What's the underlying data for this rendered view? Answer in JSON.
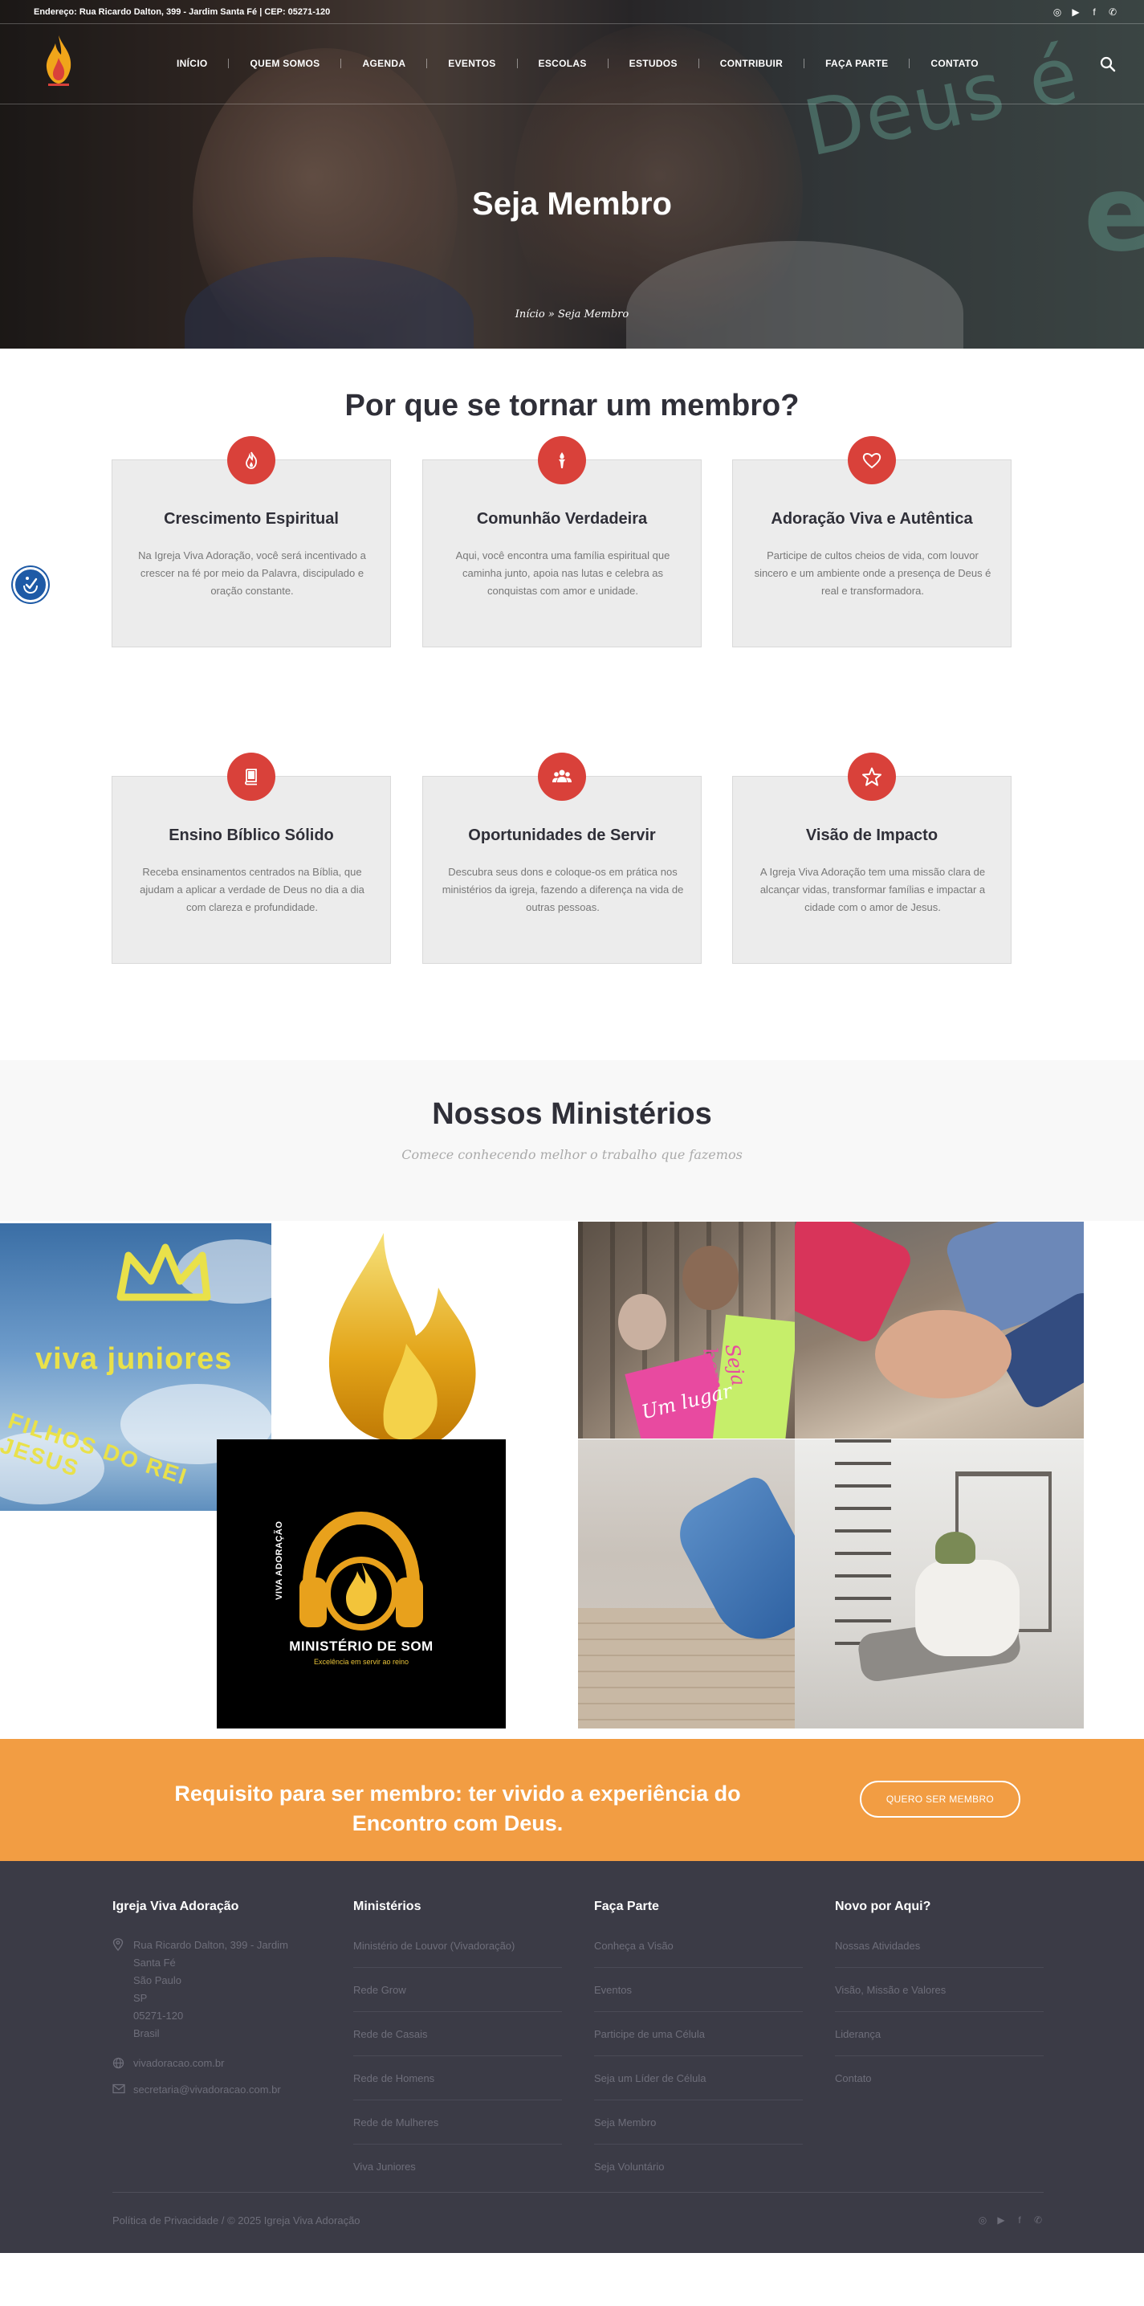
{
  "topbar": {
    "address": "Endereço: Rua Ricardo Dalton, 399 - Jardim Santa Fé | CEP: 05271-120",
    "social": [
      "instagram-icon",
      "youtube-icon",
      "facebook-icon",
      "whatsapp-icon"
    ]
  },
  "nav": {
    "items": [
      "INÍCIO",
      "QUEM SOMOS",
      "AGENDA",
      "EVENTOS",
      "ESCOLAS",
      "ESTUDOS",
      "CONTRIBUIR",
      "FAÇA PARTE",
      "CONTATO"
    ]
  },
  "hero": {
    "title": "Seja Membro",
    "breadcrumb": {
      "home": "Início",
      "separator": "»",
      "current": "Seja Membro"
    },
    "background_text": "Deus é"
  },
  "why": {
    "title": "Por que se tornar um membro?",
    "cards": [
      {
        "icon": "fire-icon",
        "title": "Crescimento Espiritual",
        "text": "Na Igreja Viva Adoração, você será incentivado a crescer na fé por meio da Palavra, discipulado e oração constante."
      },
      {
        "icon": "torch-icon",
        "title": "Comunhão Verdadeira",
        "text": "Aqui, você encontra uma família espiritual que caminha junto, apoia nas lutas e celebra as conquistas com amor e unidade."
      },
      {
        "icon": "heart-icon",
        "title": "Adoração Viva e Autêntica",
        "text": "Participe de cultos cheios de vida, com louvor sincero e um ambiente onde a presença de Deus é real e transformadora."
      },
      {
        "icon": "book-icon",
        "title": "Ensino Bíblico Sólido",
        "text": "Receba ensinamentos centrados na Bíblia, que ajudam a aplicar a verdade de Deus no dia a dia com clareza e profundidade."
      },
      {
        "icon": "users-icon",
        "title": "Oportunidades de Servir",
        "text": "Descubra seus dons e coloque-os em prática nos ministérios da igreja, fazendo a diferença na vida de outras pessoas."
      },
      {
        "icon": "star-icon",
        "title": "Visão de Impacto",
        "text": "A Igreja Viva Adoração tem uma missão clara de alcançar vidas, transformar famílias e impactar a cidade com o amor de Jesus."
      }
    ]
  },
  "ministries": {
    "title": "Nossos Ministérios",
    "subtitle": "Comece conhecendo melhor o trabalho que fazemos",
    "juniores": {
      "title": "viva juniores",
      "subtitle": "FILHOS DO REI JESUS"
    },
    "som": {
      "name": "MINISTÉRIO DE SOM",
      "tagline": "Excelência em servir ao reino",
      "vertical": "VIVA ADORAÇÃO"
    },
    "photo_signs": [
      "Um lugar",
      "Seja bem"
    ]
  },
  "cta": {
    "text": "Requisito para ser membro: ter vivido a experiência do Encontro com Deus.",
    "button": "QUERO SER MEMBRO"
  },
  "footer": {
    "col1": {
      "title": "Igreja Viva Adoração",
      "address": [
        "Rua Ricardo Dalton, 399 - Jardim",
        "Santa Fé",
        "São Paulo",
        "SP",
        "05271-120",
        "Brasil"
      ],
      "website": "vivadoracao.com.br",
      "email": "secretaria@vivadoracao.com.br"
    },
    "col2": {
      "title": "Ministérios",
      "links": [
        "Ministério de Louvor (Vivadoração)",
        "Rede Grow",
        "Rede de Casais",
        "Rede de Homens",
        "Rede de Mulheres",
        "Viva Juniores"
      ]
    },
    "col3": {
      "title": "Faça Parte",
      "links": [
        "Conheça a Visão",
        "Eventos",
        "Participe de uma Célula",
        "Seja um Líder de Célula",
        "Seja Membro",
        "Seja Voluntário"
      ]
    },
    "col4": {
      "title": "Novo por Aqui?",
      "links": [
        "Nossas Atividades",
        "Visão, Missão e Valores",
        "Liderança",
        "Contato"
      ]
    },
    "copyright": "Política de Privacidade / © 2025 Igreja Viva Adoração",
    "social": [
      "instagram-icon",
      "youtube-icon",
      "facebook-icon",
      "whatsapp-icon"
    ]
  },
  "colors": {
    "accent_red": "#d9413a",
    "cta_orange": "#f29d43",
    "footer_bg": "#3b3b46",
    "heading": "#2f2f38",
    "accessibility_blue": "#1e5aa6"
  }
}
